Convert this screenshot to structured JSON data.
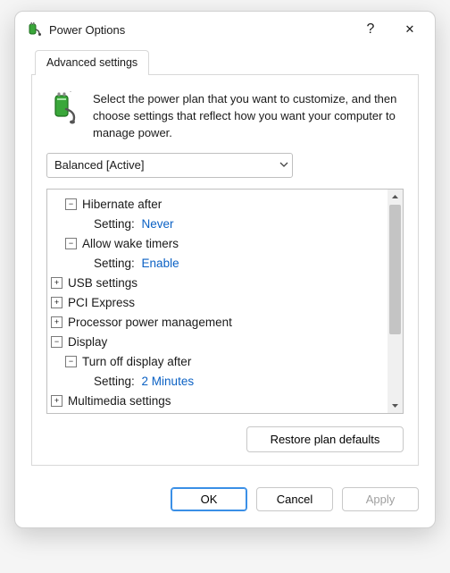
{
  "window": {
    "title": "Power Options",
    "help_button_glyph": "?",
    "close_button_glyph": "✕"
  },
  "tab": {
    "label": "Advanced settings"
  },
  "intro_text": "Select the power plan that you want to customize, and then choose settings that reflect how you want your computer to manage power.",
  "plan_selector": {
    "selected": "Balanced [Active]"
  },
  "tree": {
    "hibernate_after_label": "Hibernate after",
    "hibernate_after_setting_label": "Setting:",
    "hibernate_after_value": "Never",
    "allow_wake_timers_label": "Allow wake timers",
    "allow_wake_timers_setting_label": "Setting:",
    "allow_wake_timers_value": "Enable",
    "usb_settings_label": "USB settings",
    "pci_express_label": "PCI Express",
    "processor_pm_label": "Processor power management",
    "display_label": "Display",
    "turn_off_display_label": "Turn off display after",
    "turn_off_display_setting_label": "Setting:",
    "turn_off_display_value": "2 Minutes",
    "multimedia_label": "Multimedia settings",
    "sq_minus": "−",
    "sq_plus": "+"
  },
  "restore_button": "Restore plan defaults",
  "buttons": {
    "ok": "OK",
    "cancel": "Cancel",
    "apply": "Apply"
  }
}
